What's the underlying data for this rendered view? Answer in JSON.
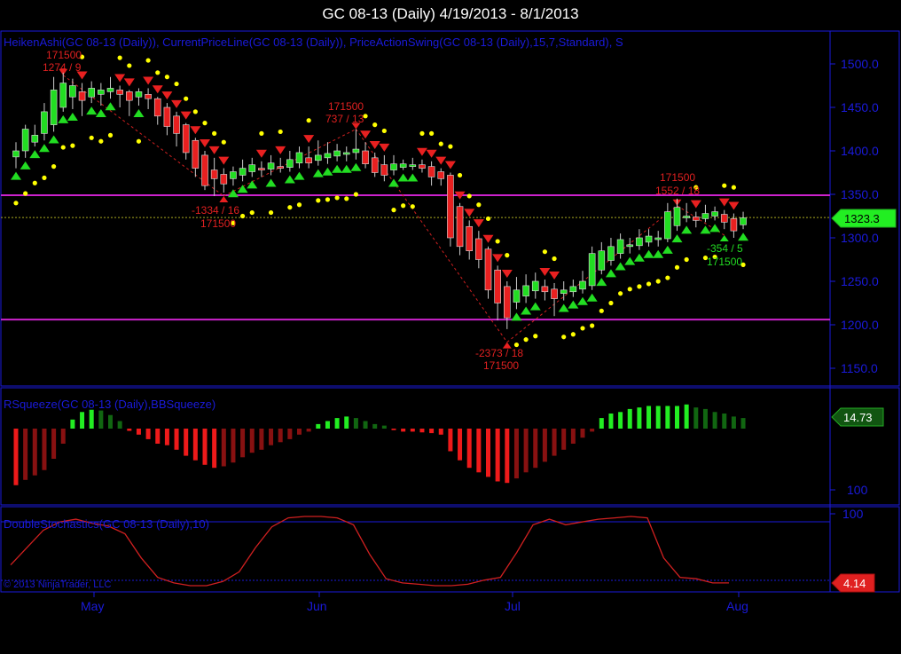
{
  "title": "GC 08-13 (Daily)  4/19/2013 - 8/1/2013",
  "colors": {
    "frame": "#1a1adb",
    "up_candle": "#22dd22",
    "down_candle": "#e82020",
    "swing_line": "#d02020",
    "dots": "#ffff00",
    "magenta": "#cc22cc",
    "squeeze_pos_bright": "#22ee22",
    "squeeze_pos_dark": "#116611",
    "squeeze_neg_bright": "#ee1a1a",
    "squeeze_neg_dark": "#881111",
    "stoch_line": "#d02020"
  },
  "price_panel": {
    "label": "HeikenAshi(GC 08-13 (Daily)), CurrentPriceLine(GC 08-13 (Daily)), PriceActionSwing(GC 08-13 (Daily),15,7,Standard), S",
    "y_ticks": [
      "1500.0",
      "1450.0",
      "1400.0",
      "1350.0",
      "1300.0",
      "1250.0",
      "1200.0",
      "1150.0"
    ],
    "current_price": "1323.3",
    "horizontal_lines": [
      1349,
      1206
    ],
    "annotations": [
      {
        "line1": "171500",
        "line2": "1274 / 9",
        "color": "red"
      },
      {
        "line1": "171500",
        "line2": "737 / 13",
        "color": "red"
      },
      {
        "line1": "-1334 / 16",
        "line2": "171500",
        "color": "red"
      },
      {
        "line1": "-2373 / 18",
        "line2": "171500",
        "color": "red"
      },
      {
        "line1": "171500",
        "line2": "1552 / 18",
        "color": "red"
      },
      {
        "line1": "-354 / 5",
        "line2": "171500",
        "color": "green"
      }
    ]
  },
  "squeeze_panel": {
    "label": "RSqueeze(GC 08-13 (Daily),BBSqueeze)",
    "y_ticks": [
      "100"
    ],
    "current_value": "14.73"
  },
  "stoch_panel": {
    "label": "DoubleStochastics(GC 08-13 (Daily),10)",
    "y_ticks": [
      "100"
    ],
    "current_value": "4.14",
    "copyright": "© 2013 NinjaTrader, LLC"
  },
  "x_axis": {
    "ticks": [
      "May",
      "Jun",
      "Jul",
      "Aug"
    ]
  },
  "chart_data": {
    "type": "candlestick",
    "title": "GC 08-13 (Daily)  4/19/2013 - 8/1/2013",
    "ylim": [
      1120,
      1530
    ],
    "heiken_ashi": [
      {
        "o": 1393,
        "c": 1400,
        "h": 1410,
        "l": 1380
      },
      {
        "o": 1400,
        "c": 1425,
        "h": 1430,
        "l": 1392
      },
      {
        "o": 1410,
        "c": 1418,
        "h": 1430,
        "l": 1405
      },
      {
        "o": 1420,
        "c": 1445,
        "h": 1455,
        "l": 1412
      },
      {
        "o": 1430,
        "c": 1470,
        "h": 1485,
        "l": 1422
      },
      {
        "o": 1450,
        "c": 1478,
        "h": 1490,
        "l": 1445
      },
      {
        "o": 1462,
        "c": 1475,
        "h": 1483,
        "l": 1448
      },
      {
        "o": 1468,
        "c": 1458,
        "h": 1478,
        "l": 1440
      },
      {
        "o": 1462,
        "c": 1472,
        "h": 1480,
        "l": 1455
      },
      {
        "o": 1465,
        "c": 1470,
        "h": 1478,
        "l": 1452
      },
      {
        "o": 1468,
        "c": 1472,
        "h": 1485,
        "l": 1460
      },
      {
        "o": 1470,
        "c": 1465,
        "h": 1475,
        "l": 1450
      },
      {
        "o": 1468,
        "c": 1458,
        "h": 1470,
        "l": 1440
      },
      {
        "o": 1462,
        "c": 1468,
        "h": 1472,
        "l": 1452
      },
      {
        "o": 1465,
        "c": 1460,
        "h": 1472,
        "l": 1448
      },
      {
        "o": 1460,
        "c": 1440,
        "h": 1462,
        "l": 1430
      },
      {
        "o": 1450,
        "c": 1428,
        "h": 1455,
        "l": 1418
      },
      {
        "o": 1440,
        "c": 1420,
        "h": 1445,
        "l": 1405
      },
      {
        "o": 1430,
        "c": 1398,
        "h": 1432,
        "l": 1390
      },
      {
        "o": 1412,
        "c": 1380,
        "h": 1415,
        "l": 1370
      },
      {
        "o": 1395,
        "c": 1360,
        "h": 1400,
        "l": 1355
      },
      {
        "o": 1378,
        "c": 1368,
        "h": 1392,
        "l": 1348
      },
      {
        "o": 1373,
        "c": 1362,
        "h": 1380,
        "l": 1352
      },
      {
        "o": 1368,
        "c": 1376,
        "h": 1382,
        "l": 1360
      },
      {
        "o": 1372,
        "c": 1380,
        "h": 1390,
        "l": 1365
      },
      {
        "o": 1376,
        "c": 1384,
        "h": 1392,
        "l": 1370
      },
      {
        "o": 1380,
        "c": 1378,
        "h": 1388,
        "l": 1370
      },
      {
        "o": 1379,
        "c": 1386,
        "h": 1395,
        "l": 1372
      },
      {
        "o": 1382,
        "c": 1380,
        "h": 1392,
        "l": 1375
      },
      {
        "o": 1381,
        "c": 1390,
        "h": 1400,
        "l": 1376
      },
      {
        "o": 1386,
        "c": 1398,
        "h": 1405,
        "l": 1380
      },
      {
        "o": 1392,
        "c": 1386,
        "h": 1405,
        "l": 1380
      },
      {
        "o": 1389,
        "c": 1395,
        "h": 1412,
        "l": 1383
      },
      {
        "o": 1392,
        "c": 1397,
        "h": 1410,
        "l": 1385
      },
      {
        "o": 1394,
        "c": 1400,
        "h": 1408,
        "l": 1388
      },
      {
        "o": 1397,
        "c": 1398,
        "h": 1405,
        "l": 1388
      },
      {
        "o": 1398,
        "c": 1402,
        "h": 1425,
        "l": 1390
      },
      {
        "o": 1400,
        "c": 1385,
        "h": 1410,
        "l": 1380
      },
      {
        "o": 1392,
        "c": 1375,
        "h": 1398,
        "l": 1370
      },
      {
        "o": 1384,
        "c": 1372,
        "h": 1395,
        "l": 1365
      },
      {
        "o": 1378,
        "c": 1385,
        "h": 1395,
        "l": 1372
      },
      {
        "o": 1381,
        "c": 1385,
        "h": 1390,
        "l": 1378
      },
      {
        "o": 1383,
        "c": 1384,
        "h": 1392,
        "l": 1378
      },
      {
        "o": 1384,
        "c": 1380,
        "h": 1390,
        "l": 1375
      },
      {
        "o": 1382,
        "c": 1370,
        "h": 1388,
        "l": 1360
      },
      {
        "o": 1376,
        "c": 1368,
        "h": 1380,
        "l": 1360
      },
      {
        "o": 1372,
        "c": 1300,
        "h": 1375,
        "l": 1290
      },
      {
        "o": 1336,
        "c": 1290,
        "h": 1340,
        "l": 1280
      },
      {
        "o": 1313,
        "c": 1285,
        "h": 1320,
        "l": 1275
      },
      {
        "o": 1299,
        "c": 1275,
        "h": 1308,
        "l": 1265
      },
      {
        "o": 1287,
        "c": 1240,
        "h": 1290,
        "l": 1230
      },
      {
        "o": 1263,
        "c": 1225,
        "h": 1268,
        "l": 1205
      },
      {
        "o": 1244,
        "c": 1208,
        "h": 1250,
        "l": 1195
      },
      {
        "o": 1226,
        "c": 1240,
        "h": 1255,
        "l": 1218
      },
      {
        "o": 1233,
        "c": 1245,
        "h": 1258,
        "l": 1225
      },
      {
        "o": 1239,
        "c": 1250,
        "h": 1260,
        "l": 1230
      },
      {
        "o": 1244,
        "c": 1238,
        "h": 1252,
        "l": 1228
      },
      {
        "o": 1241,
        "c": 1230,
        "h": 1248,
        "l": 1210
      },
      {
        "o": 1236,
        "c": 1240,
        "h": 1250,
        "l": 1228
      },
      {
        "o": 1238,
        "c": 1244,
        "h": 1252,
        "l": 1232
      },
      {
        "o": 1241,
        "c": 1250,
        "h": 1262,
        "l": 1236
      },
      {
        "o": 1245,
        "c": 1282,
        "h": 1290,
        "l": 1240
      },
      {
        "o": 1263,
        "c": 1285,
        "h": 1295,
        "l": 1258
      },
      {
        "o": 1274,
        "c": 1290,
        "h": 1300,
        "l": 1268
      },
      {
        "o": 1282,
        "c": 1298,
        "h": 1305,
        "l": 1276
      },
      {
        "o": 1290,
        "c": 1292,
        "h": 1300,
        "l": 1282
      },
      {
        "o": 1291,
        "c": 1300,
        "h": 1310,
        "l": 1286
      },
      {
        "o": 1295,
        "c": 1302,
        "h": 1310,
        "l": 1290
      },
      {
        "o": 1298,
        "c": 1300,
        "h": 1308,
        "l": 1290
      },
      {
        "o": 1299,
        "c": 1330,
        "h": 1340,
        "l": 1295
      },
      {
        "o": 1314,
        "c": 1335,
        "h": 1345,
        "l": 1308
      },
      {
        "o": 1324,
        "c": 1325,
        "h": 1340,
        "l": 1318
      },
      {
        "o": 1324,
        "c": 1320,
        "h": 1330,
        "l": 1312
      },
      {
        "o": 1322,
        "c": 1328,
        "h": 1338,
        "l": 1318
      },
      {
        "o": 1325,
        "c": 1330,
        "h": 1336,
        "l": 1320
      },
      {
        "o": 1327,
        "c": 1318,
        "h": 1332,
        "l": 1310
      },
      {
        "o": 1322,
        "c": 1308,
        "h": 1328,
        "l": 1300
      },
      {
        "o": 1315,
        "c": 1323,
        "h": 1330,
        "l": 1310
      }
    ],
    "swing_points": [
      {
        "type": "high",
        "value": 1487,
        "label": "1274 / 9"
      },
      {
        "type": "low",
        "value": 1348,
        "label": "-1334 / 16"
      },
      {
        "type": "high",
        "value": 1425,
        "label": "737 / 13"
      },
      {
        "type": "low",
        "value": 1180,
        "label": "-2373 / 18"
      },
      {
        "type": "high",
        "value": 1337,
        "label": "1552 / 18"
      },
      {
        "type": "low",
        "value": 1303,
        "label": "-354 / 5"
      }
    ],
    "squeeze": [
      -75,
      -68,
      -62,
      -55,
      -40,
      -20,
      12,
      22,
      25,
      24,
      18,
      10,
      -3,
      -8,
      -14,
      -20,
      -22,
      -28,
      -36,
      -42,
      -48,
      -52,
      -50,
      -45,
      -38,
      -32,
      -28,
      -22,
      -18,
      -14,
      -8,
      -4,
      6,
      10,
      14,
      16,
      14,
      10,
      6,
      4,
      -2,
      -4,
      -4,
      -5,
      -6,
      -8,
      -30,
      -42,
      -52,
      -58,
      -64,
      -70,
      -72,
      -66,
      -58,
      -52,
      -44,
      -36,
      -28,
      -20,
      -12,
      -4,
      14,
      20,
      22,
      26,
      28,
      30,
      30,
      30,
      30,
      32,
      28,
      26,
      22,
      20,
      16,
      14
    ],
    "stochastics": [
      30,
      55,
      80,
      92,
      96,
      90,
      86,
      75,
      40,
      12,
      4,
      0,
      0,
      6,
      20,
      55,
      85,
      98,
      100,
      100,
      98,
      88,
      45,
      10,
      4,
      2,
      0,
      0,
      2,
      8,
      12,
      48,
      88,
      96,
      88,
      92,
      96,
      98,
      100,
      98,
      40,
      12,
      10,
      4,
      4
    ]
  }
}
